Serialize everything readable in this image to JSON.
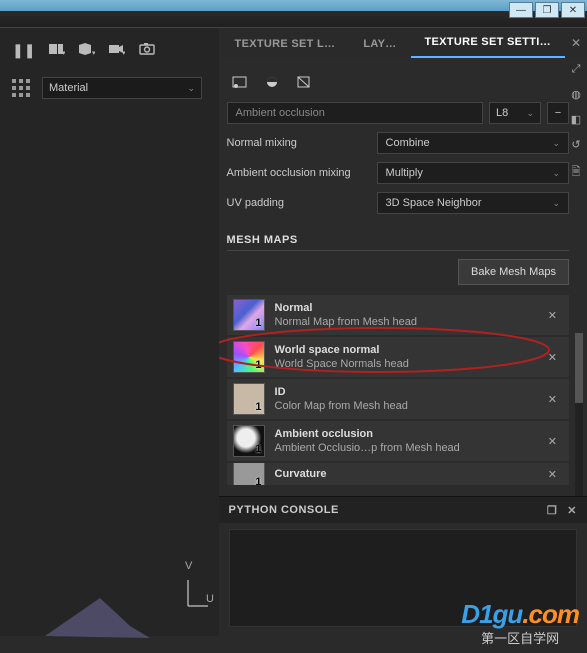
{
  "titlebar": {
    "min": "—",
    "max": "❐",
    "close": "✕"
  },
  "left": {
    "material": "Material",
    "axes": {
      "u": "U",
      "v": "V"
    }
  },
  "tabs": {
    "t1": "TEXTURE SET L…",
    "t2": "LAY…",
    "t3": "TEXTURE SET SETTI…"
  },
  "channel": {
    "input": "Ambient occlusion",
    "fmt": "L8"
  },
  "props": {
    "nm_label": "Normal mixing",
    "nm_val": "Combine",
    "ao_label": "Ambient occlusion mixing",
    "ao_val": "Multiply",
    "uv_label": "UV padding",
    "uv_val": "3D Space Neighbor"
  },
  "mesh": {
    "title": "MESH MAPS",
    "bake": "Bake Mesh Maps",
    "items": [
      {
        "name": "Normal",
        "desc": "Normal Map from Mesh head"
      },
      {
        "name": "World space normal",
        "desc": "World Space Normals head"
      },
      {
        "name": "ID",
        "desc": "Color Map from Mesh head"
      },
      {
        "name": "Ambient occlusion",
        "desc": "Ambient Occlusio…p from Mesh head"
      },
      {
        "name": "Curvature",
        "desc": ""
      }
    ],
    "thumb_num": "1"
  },
  "console": {
    "title": "PYTHON CONSOLE"
  },
  "watermark": {
    "l1a": "D1",
    "l1b": "gu",
    "l1c": ".com",
    "l2": "第一区自学网"
  }
}
